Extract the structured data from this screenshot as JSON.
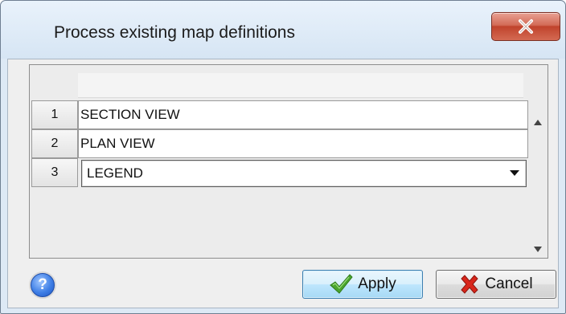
{
  "window": {
    "title": "Process existing map definitions",
    "close_icon": "close-x-icon"
  },
  "grid": {
    "rows": [
      {
        "number": "1",
        "value": "SECTION VIEW"
      },
      {
        "number": "2",
        "value": "PLAN VIEW"
      },
      {
        "number": "3",
        "value": "LEGEND",
        "editor": "dropdown"
      }
    ],
    "scroll_up_icon": "triangle-up-icon",
    "scroll_down_icon": "triangle-down-icon"
  },
  "footer": {
    "help_label": "?",
    "apply_label": "Apply",
    "apply_icon": "checkmark-icon",
    "cancel_label": "Cancel",
    "cancel_icon": "red-x-icon"
  },
  "colors": {
    "close_button": "#c94a35",
    "apply_check": "#4aa52e",
    "cancel_x": "#d8261b",
    "help_button": "#3f7fe6"
  }
}
